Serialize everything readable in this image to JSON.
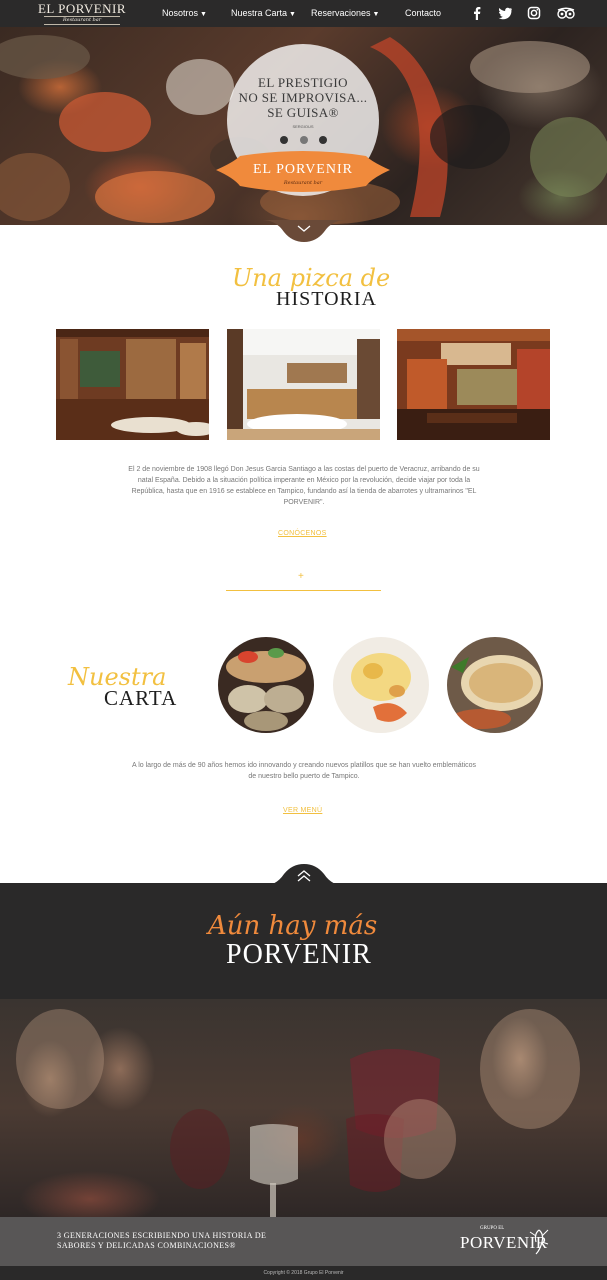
{
  "nav": {
    "logo_name": "EL PORVENIR",
    "logo_sub": "Restaurant bar",
    "items": [
      {
        "label": "Nosotros",
        "dropdown": true
      },
      {
        "label": "Nuestra Carta",
        "dropdown": true
      },
      {
        "label": "Reservaciones",
        "dropdown": true
      },
      {
        "label": "Contacto",
        "dropdown": false
      }
    ],
    "social": [
      "facebook-icon",
      "twitter-icon",
      "instagram-icon",
      "tripadvisor-icon"
    ]
  },
  "hero": {
    "line1": "EL PRESTIGIO",
    "line2": "NO SE IMPROVISA...",
    "line3": "SE GUISA®",
    "signature": "SERGIOUS",
    "brand": "EL PORVENIR",
    "brand_sub": "Restaurant bar"
  },
  "historia": {
    "script": "Una pizca de",
    "caps": "HISTORIA",
    "text": "El 2 de noviembre de 1908 llegó Don Jesus Garcia Santiago a las costas del puerto de Veracruz, arribando de su natal España. Debido a la situación política imperante en México por la revolución, decide viajar por toda la República, hasta que en 1916 se establece en Tampico, fundando así la tienda de abarrotes y ultramarinos \"EL PORVENIR\".",
    "link": "CONÓCENOS",
    "divider_plus": "+"
  },
  "carta": {
    "script": "Nuestra",
    "caps": "CARTA",
    "text": "A lo largo de más de 90 años hemos ido innovando y creando nuevos platillos que se han vuelto emblemáticos de nuestro bello puerto de Tampico.",
    "link": "VER MENÚ"
  },
  "mas": {
    "script": "Aún hay más",
    "caps": "PORVENIR"
  },
  "footer": {
    "line1": "3 GENERACIONES ESCRIBIENDO UNA HISTORIA DE",
    "line2": "SABORES Y DELICADAS COMBINACIONES®",
    "logo_top": "GRUPO EL",
    "logo_name": "PORVENIR",
    "copyright": "Copyright © 2018 Grupo El Porvenir"
  },
  "colors": {
    "accent_gold": "#f2c040",
    "accent_orange": "#f08a3c",
    "dark": "#2a2929"
  }
}
